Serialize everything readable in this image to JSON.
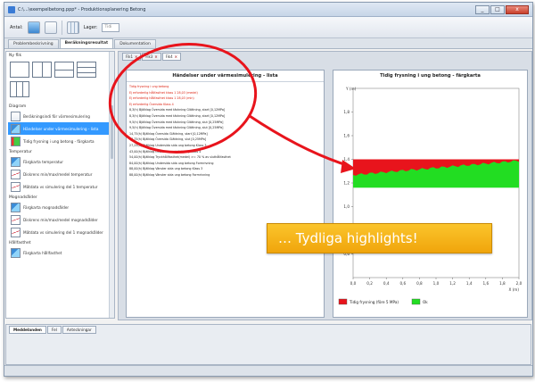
{
  "window": {
    "title": "C:\\...\\exempelbetong.ppp* - Produktionsplanering Betong",
    "controls": [
      "_",
      "□",
      "x"
    ]
  },
  "toolbar": {
    "label_a": "Antal:",
    "label_b": "Lager:",
    "select_value": "Tidi"
  },
  "main_tabs": [
    {
      "label": "Problembeskrivning",
      "active": false
    },
    {
      "label": "Beräkningsresultat",
      "active": true
    },
    {
      "label": "Dokumentation",
      "active": false
    }
  ],
  "left_panel": {
    "heading": "Ny flik",
    "groups": [
      {
        "title": "Diagram",
        "items": [
          {
            "label": "Beräkningsindi för värmesimulering",
            "icon": "doc",
            "selected": false
          },
          {
            "label": "Händelser under värmesimulering - lista",
            "icon": "map",
            "selected": true
          },
          {
            "label": "Tidig frysning i ung betong - färgkarta",
            "icon": "colr",
            "selected": false
          }
        ]
      },
      {
        "title": "Temperatur",
        "items": [
          {
            "label": "Färgkarta temperatur",
            "icon": "map",
            "selected": false
          },
          {
            "label": "Diskrens min/max/medel temperatur",
            "icon": "line",
            "selected": false
          },
          {
            "label": "Mätdata vs simulering del 1 temperatur",
            "icon": "line",
            "selected": false
          }
        ]
      },
      {
        "title": "Mognadsålder",
        "items": [
          {
            "label": "Färgkarta mognadsålder",
            "icon": "map",
            "selected": false
          },
          {
            "label": "Diskrens min/max/medel mognadsålder",
            "icon": "line",
            "selected": false
          },
          {
            "label": "Mätdata vs simulering del 1 mognadsålder",
            "icon": "line",
            "selected": false
          }
        ]
      },
      {
        "title": "Hållfasthet",
        "items": [
          {
            "label": "Färgkarta hållfasthet",
            "icon": "map",
            "selected": false
          }
        ]
      }
    ]
  },
  "sub_tabs": [
    {
      "label": "Fik1",
      "active": false
    },
    {
      "label": "Fik3",
      "active": false
    },
    {
      "label": "Fik4",
      "active": true
    }
  ],
  "log": {
    "title": "Händelser under värmesimulering - lista",
    "lines": [
      {
        "text": "Tidig frysning i ung betong",
        "red": true
      },
      {
        "text": "Ej erforderlig hållfasthet klass 1 28,03 (medel)",
        "red": true
      },
      {
        "text": "Ej erforderlig hållfasthet klass 1 28,03 (min)",
        "red": true
      },
      {
        "text": "Ej erforderlig Översida Klass 4",
        "red": true
      },
      {
        "text": "8,3(h) Bjälklag Översida med täckning Glättning, start [0,12MPa]",
        "red": false
      },
      {
        "text": "8,3(h) Bjälklag Översida med täckning Glättning, start [0,12MPa]",
        "red": false
      },
      {
        "text": "9,5(h) Bjälklag Översida med täckning Glättning, slut [0,25MPa]",
        "red": false
      },
      {
        "text": "9,5(h) Bjälklag Översida med täckning Glättning, slut [0,25MPa]",
        "red": false
      },
      {
        "text": "14,75(h) Bjälklag Översida Glättning, start [0,12MPa]",
        "red": false
      },
      {
        "text": "16,75(h) Bjälklag Översida Glättning, slut [0,25MPa]",
        "red": false
      },
      {
        "text": "27,25(h) Bjälklag Undersida sida ung betong Klass 3",
        "red": false
      },
      {
        "text": "43,00(h) Bjälklag Översida med täckning Klass 4",
        "red": false
      },
      {
        "text": "54,00(h) Bjälklag Tryckhållfasthet(medel) >= 70 % av sluthållfasthet",
        "red": false
      },
      {
        "text": "84,00(h) Bjälklag Undersida sida ung betong Formrivning",
        "red": false
      },
      {
        "text": "88,00(h) Bjälklag Vänster sida ung betong Klass 3",
        "red": false
      },
      {
        "text": "88,00(h) Bjälklag Vänster sida ung betong Formrivning",
        "red": false
      }
    ]
  },
  "chart_data": {
    "type": "heatmap",
    "title": "Tidig frysning i ung betong - färgkarta",
    "ylabel": "Y (m)",
    "xlabel": "X (m)",
    "xlim": [
      0.0,
      2.0
    ],
    "ylim": [
      0.4,
      2.0
    ],
    "x_ticks": [
      "0,0",
      "0,2",
      "0,4",
      "0,6",
      "0,8",
      "1,0",
      "1,2",
      "1,4",
      "1,6",
      "1,8",
      "2,0"
    ],
    "y_ticks": [
      "0,6",
      "0,8",
      "1,0",
      "1,2",
      "1,4",
      "1,6",
      "1,8"
    ],
    "band": {
      "y_bottom": 1.16,
      "y_top": 1.4
    },
    "legend": [
      {
        "label": "Tidig frysning (före 5 MPa)",
        "color": "#e8141c"
      },
      {
        "label": "Ok",
        "color": "#22dd22"
      }
    ]
  },
  "bottom_panel": {
    "tabs": [
      {
        "label": "Meddelanden",
        "active": true
      },
      {
        "label": "Fel",
        "active": false
      },
      {
        "label": "Anteckningar",
        "active": false
      }
    ]
  },
  "callout": {
    "text": "… Tydliga highlights!",
    "color": "#f7b21c"
  },
  "highlight_color": "#e8141c"
}
